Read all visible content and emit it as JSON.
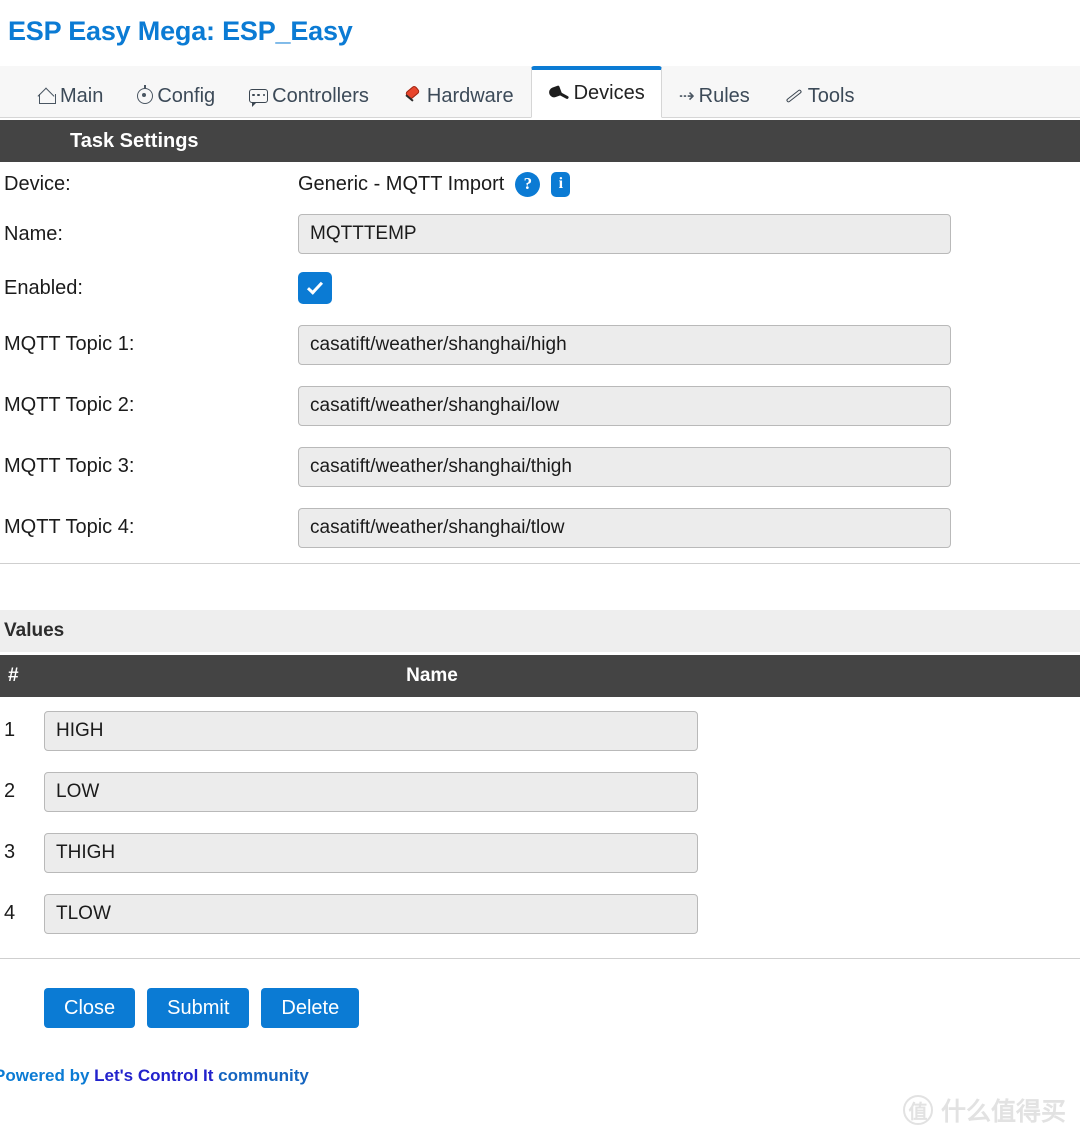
{
  "header": {
    "title": "ESP Easy Mega: ESP_Easy"
  },
  "nav": {
    "tabs": [
      {
        "label": "Main",
        "icon": "home-icon",
        "active": false
      },
      {
        "label": "Config",
        "icon": "gear-icon",
        "active": false
      },
      {
        "label": "Controllers",
        "icon": "chat-icon",
        "active": false
      },
      {
        "label": "Hardware",
        "icon": "pushpin-icon",
        "active": false
      },
      {
        "label": "Devices",
        "icon": "plug-icon",
        "active": true
      },
      {
        "label": "Rules",
        "icon": "arrow-icon",
        "active": false
      },
      {
        "label": "Tools",
        "icon": "wrench-icon",
        "active": false
      }
    ],
    "rules_icon_glyph": "⇢"
  },
  "task_settings": {
    "section_title": "Task Settings",
    "device": {
      "label": "Device:",
      "value": "Generic - MQTT Import",
      "help_glyph": "?",
      "info_glyph": "i"
    },
    "name": {
      "label": "Name:",
      "value": "MQTTTEMP",
      "placeholder": ""
    },
    "enabled": {
      "label": "Enabled:",
      "checked": true
    },
    "topics": [
      {
        "label": "MQTT Topic 1:",
        "value": "casatift/weather/shanghai/high"
      },
      {
        "label": "MQTT Topic 2:",
        "value": "casatift/weather/shanghai/low"
      },
      {
        "label": "MQTT Topic 3:",
        "value": "casatift/weather/shanghai/thigh"
      },
      {
        "label": "MQTT Topic 4:",
        "value": "casatift/weather/shanghai/tlow"
      }
    ]
  },
  "values": {
    "section_title": "Values",
    "columns": {
      "num": "#",
      "name": "Name"
    },
    "rows": [
      {
        "num": "1",
        "name": "HIGH"
      },
      {
        "num": "2",
        "name": "LOW"
      },
      {
        "num": "3",
        "name": "THIGH"
      },
      {
        "num": "4",
        "name": "TLOW"
      }
    ]
  },
  "buttons": {
    "close": "Close",
    "submit": "Submit",
    "delete": "Delete"
  },
  "footer": {
    "powered_prefix": "Powered by ",
    "brand": "Let's Control It",
    "suffix": " community"
  },
  "watermark": {
    "mark": "值",
    "text": "什么值得买"
  },
  "colors": {
    "accent_blue": "#0b7bd4",
    "dark_bar": "#444444",
    "values_band": "#eeeeee",
    "input_bg": "#ececec",
    "input_border": "#b9b9b9",
    "brand_link": "#2222cc",
    "pin_red": "#e8452c"
  }
}
